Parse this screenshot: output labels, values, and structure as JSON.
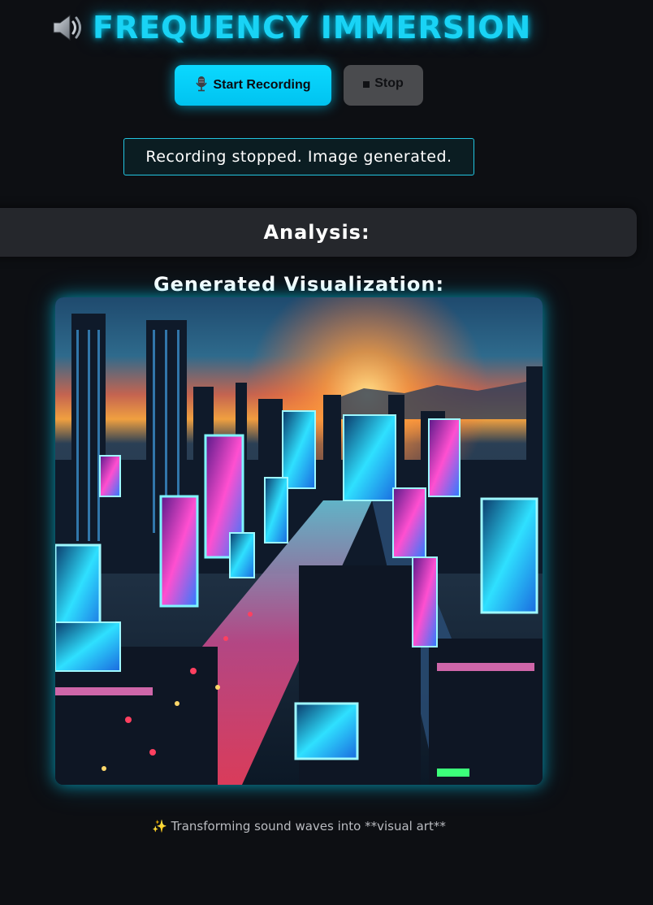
{
  "header": {
    "icon": "speaker-icon",
    "title": "FREQUENCY IMMERSION"
  },
  "controls": {
    "start_icon": "microphone-icon",
    "start_label": "Start Recording",
    "stop_icon": "stop-square-icon",
    "stop_label": "Stop"
  },
  "status": {
    "message": "Recording stopped. Image generated."
  },
  "analysis": {
    "heading": "Analysis:"
  },
  "visualization": {
    "heading": "Generated Visualization:",
    "image_description": "neon cyberpunk city at sunset"
  },
  "footer": {
    "icon": "sparkles-icon",
    "text": "Transforming sound waves into **visual art**"
  },
  "colors": {
    "background": "#0d0f13",
    "accent": "#19d3f5",
    "stop_button": "#4a4b4e",
    "panel": "#25272c"
  }
}
